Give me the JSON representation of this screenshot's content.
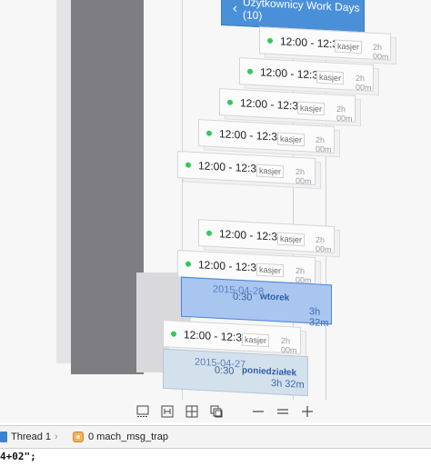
{
  "nav": {
    "back_chevron": "chevron-left-icon",
    "title": "Użytkownicy Work Days (10)"
  },
  "cells": [
    {
      "time": "12:00 - 12:32",
      "role": "kasjer",
      "duration": "2h 00m"
    },
    {
      "time": "12:00 - 12:32",
      "role": "kasjer",
      "duration": "2h 00m"
    },
    {
      "time": "12:00 - 12:32",
      "role": "kasjer",
      "duration": "2h 00m"
    },
    {
      "time": "12:00 - 12:32",
      "role": "kasjer",
      "duration": "2h 00m"
    },
    {
      "time": "12:00 - 12:32",
      "role": "kasjer",
      "duration": "2h 00m"
    },
    {
      "time": "12:00 - 12:32",
      "role": "kasjer",
      "duration": "2h 00m"
    },
    {
      "time": "12:00 - 12:32",
      "role": "kasjer",
      "duration": "2h 00m"
    },
    {
      "time": "12:00 - 12:32",
      "role": "kasjer",
      "duration": "2h 00m"
    }
  ],
  "days": [
    {
      "date": "2015-04-28",
      "weekday": "wtorek",
      "glyph": "0:30",
      "duration": "3h 32m",
      "state": "selected"
    },
    {
      "date": "2015-04-27",
      "weekday": "poniedziałek",
      "glyph": "0:30",
      "duration": "3h 32m",
      "state": "inactive"
    }
  ],
  "toolbar": {
    "buttons": [
      "align-icon",
      "resize-icon",
      "grid-icon",
      "layers-icon"
    ],
    "controls": [
      "zoom-out-icon",
      "zoom-equal-icon",
      "zoom-in-icon"
    ]
  },
  "debug": {
    "thread": "Thread 1",
    "frame": "0 mach_msg_trap",
    "code_line": "4+02\";"
  },
  "colors": {
    "accent": "#4a90d9",
    "selection": "#a9c6f0",
    "status_dot": "#35c759"
  }
}
